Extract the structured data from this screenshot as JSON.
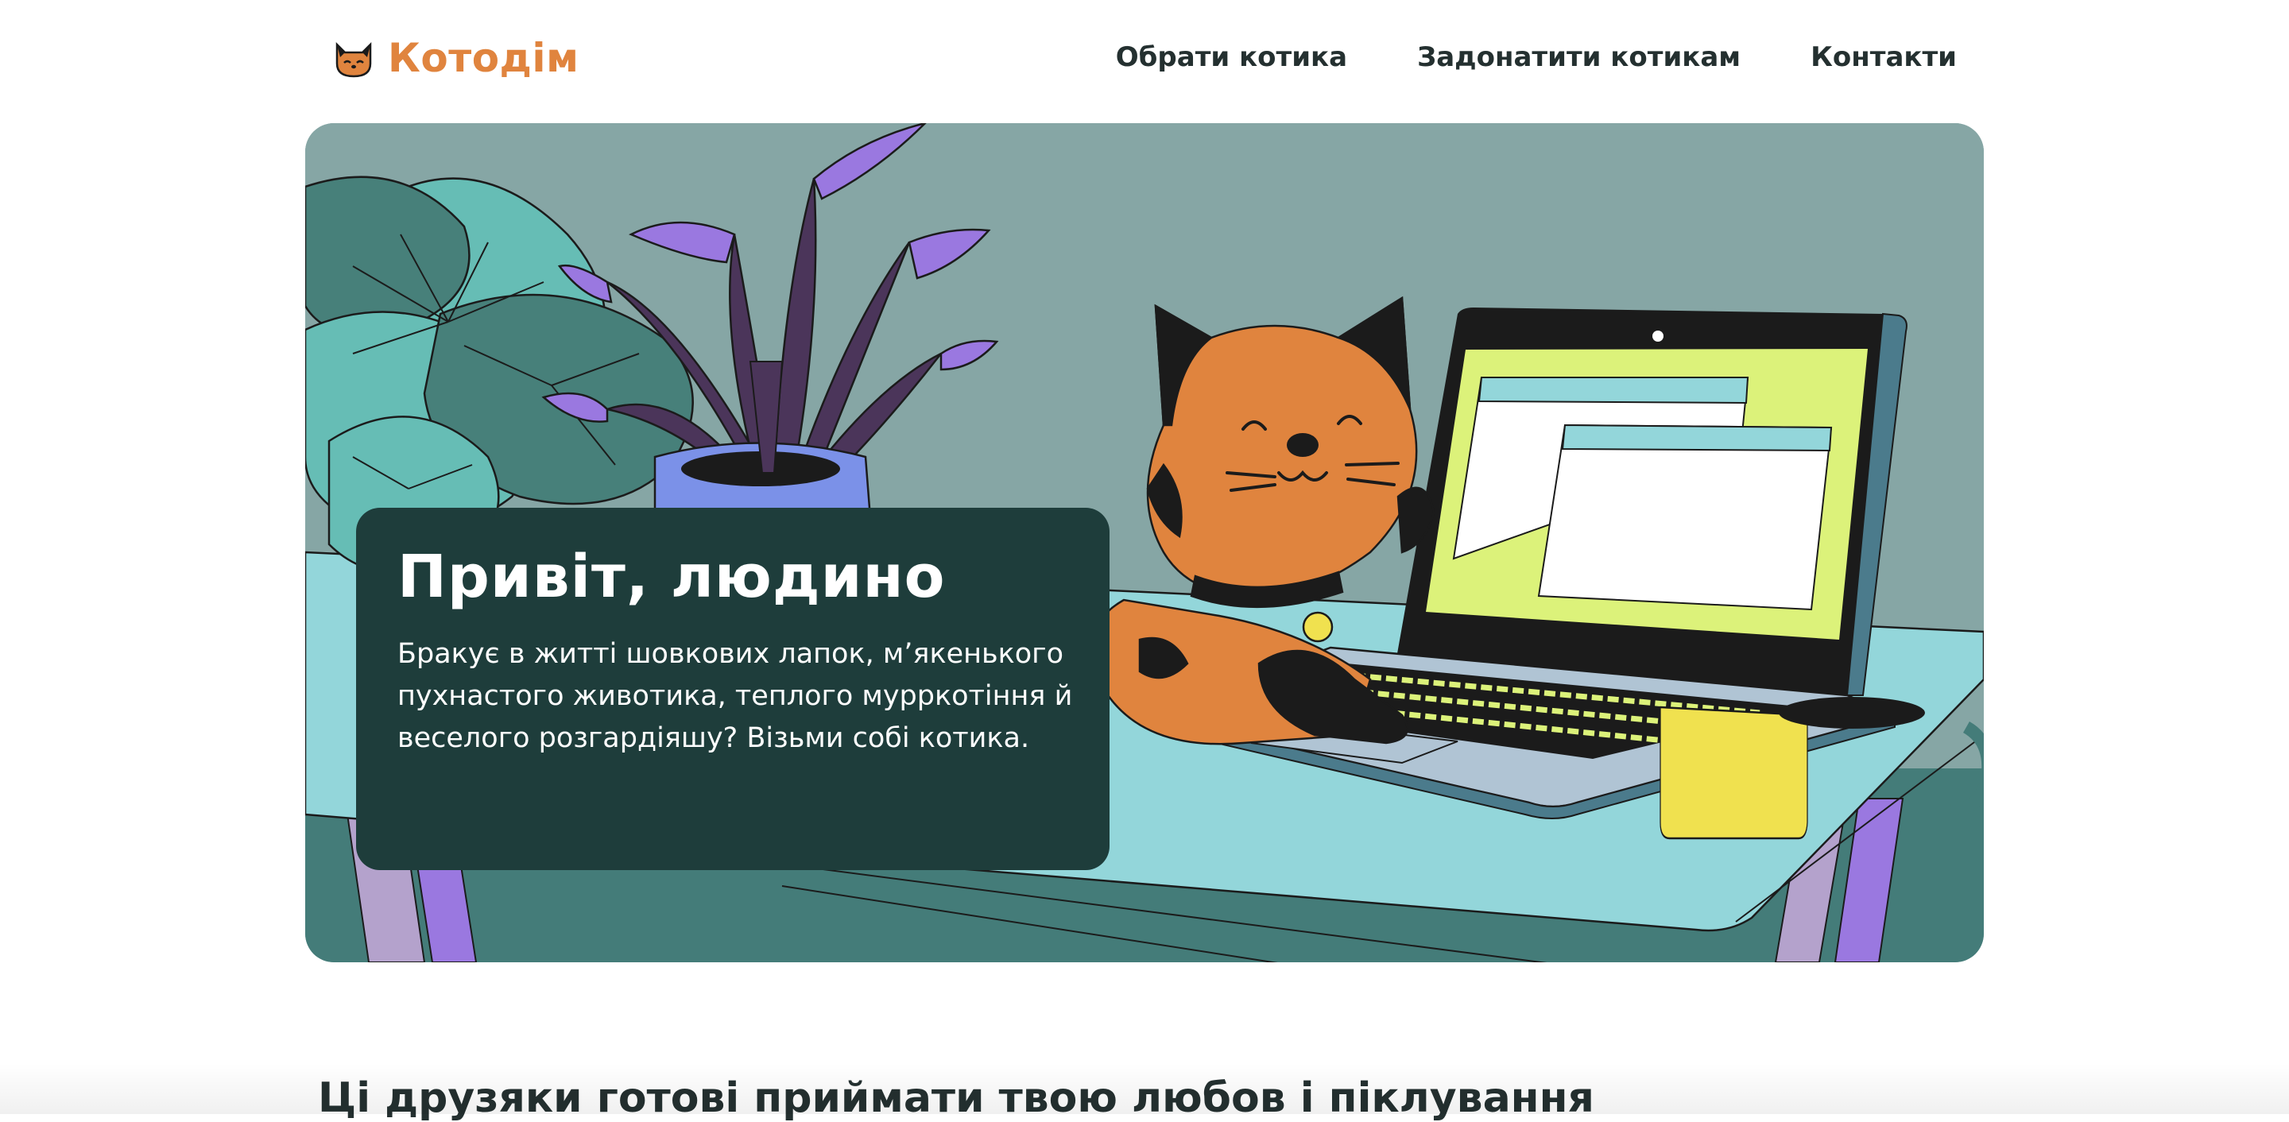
{
  "header": {
    "logo_text": "Котодім",
    "logo_icon": "cat-face-icon",
    "nav": [
      {
        "label": "Обрати котика"
      },
      {
        "label": "Задонатити котикам"
      },
      {
        "label": "Контакти"
      }
    ]
  },
  "hero": {
    "title": "Привіт, людино",
    "text": "Бракує в житті шовкових лапок, м’якенького пухнастого животика, теплого мурркотіння й веселого розгардіяшу? Візьми собі котика."
  },
  "section": {
    "title": "Ці друзяки готові приймати твою любов і піклування"
  },
  "colors": {
    "brand": "#e0843e",
    "card": "#1e3d3b",
    "wall": "#86a6a5",
    "table": "#93d6da"
  }
}
